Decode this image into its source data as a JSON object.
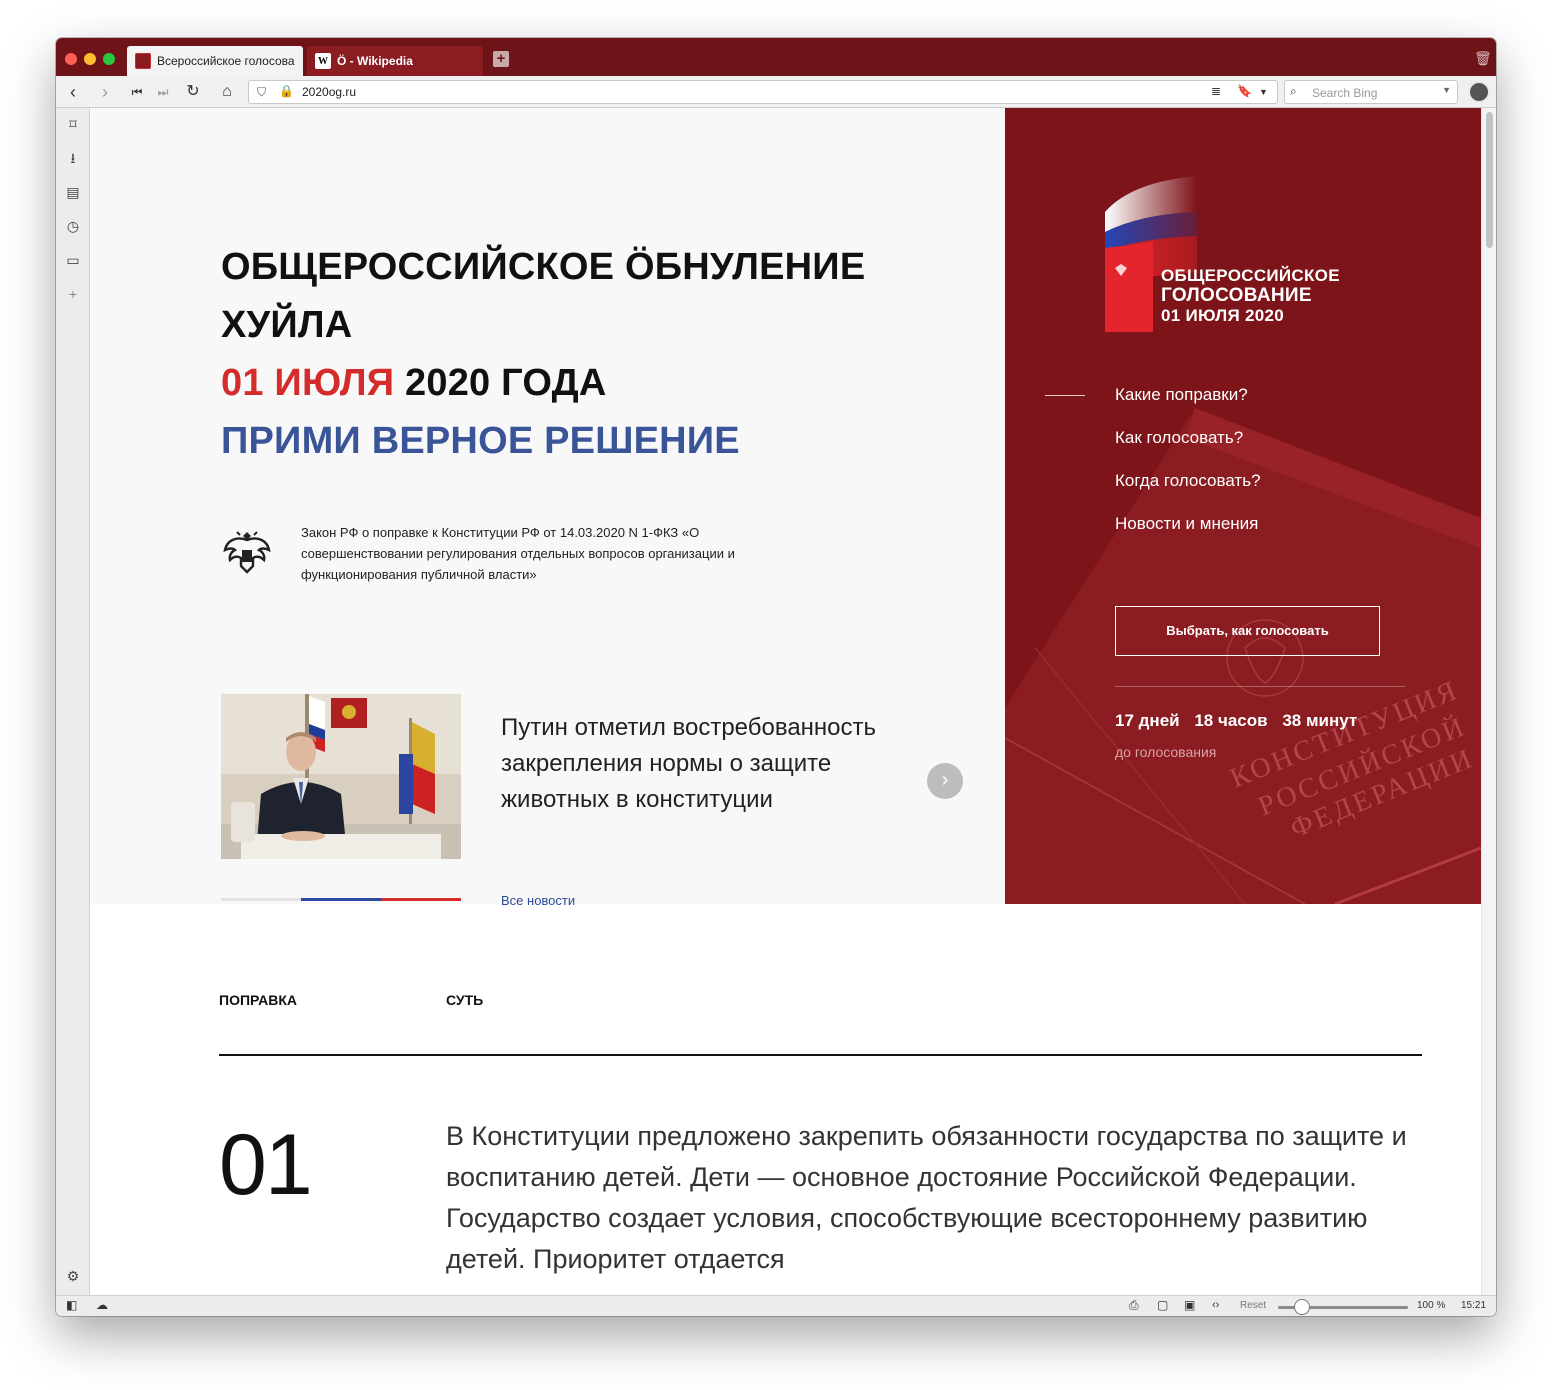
{
  "browser": {
    "tabs": [
      {
        "label": "Всероссийское голосова",
        "favicon": "vote-favicon",
        "active": true
      },
      {
        "label": "Ö - Wikipedia",
        "favicon": "wikipedia-favicon",
        "active": false
      }
    ],
    "url": "2020og.ru",
    "search_placeholder": "Search Bing",
    "status": {
      "reset": "Reset",
      "zoom": "100 %",
      "time": "15:21"
    }
  },
  "hero": {
    "title_line1": "ОБЩЕРОССИЙСКОЕ ÖБНУЛЕНИЕ",
    "title_line2": "ХУЙЛА",
    "date_red": "01 ИЮЛЯ",
    "date_rest": "2020 ГОДА",
    "slogan": "ПРИМИ ВЕРНОЕ РЕШЕНИЕ",
    "law_text": "Закон РФ о поправке к Конституции РФ от 14.03.2020 N 1-ФКЗ «О совершенствовании регулирования отдельных вопросов организации и функционирования публичной власти»"
  },
  "news": {
    "title": "Путин отметил востребованность закрепления нормы о защите животных в конституции",
    "all_news": "Все новости"
  },
  "sidepanel": {
    "logo_lines": [
      "ОБЩЕРОССИЙСКОЕ",
      "ГОЛОСОВАНИЕ",
      "01 ИЮЛЯ 2020"
    ],
    "menu": [
      "Какие поправки?",
      "Как голосовать?",
      "Когда голосовать?",
      "Новости и мнения"
    ],
    "vote_button": "Выбрать, как голосовать",
    "countdown": {
      "days": "17 дней",
      "hours": "18 часов",
      "minutes": "38 минут"
    },
    "until": "до голосования",
    "book_text": [
      "КОНСТИТУЦИЯ",
      "РОССИЙСКОЙ",
      "ФЕДЕРАЦИИ"
    ]
  },
  "amendments": {
    "col_amendment": "ПОПРАВКА",
    "col_essence": "СУТЬ",
    "items": [
      {
        "number": "01",
        "text": "В Конституции предложено закрепить обязанности государства по защите и воспитанию детей. Дети — основное достояние Российской Федерации. Государство создает условия, способствующие всестороннему развитию детей. Приоритет отдается"
      }
    ]
  },
  "colors": {
    "brand_red": "#7c1419",
    "tab_bar": "#6e1418",
    "accent_red": "#d42b2b",
    "accent_blue": "#3a5498"
  }
}
